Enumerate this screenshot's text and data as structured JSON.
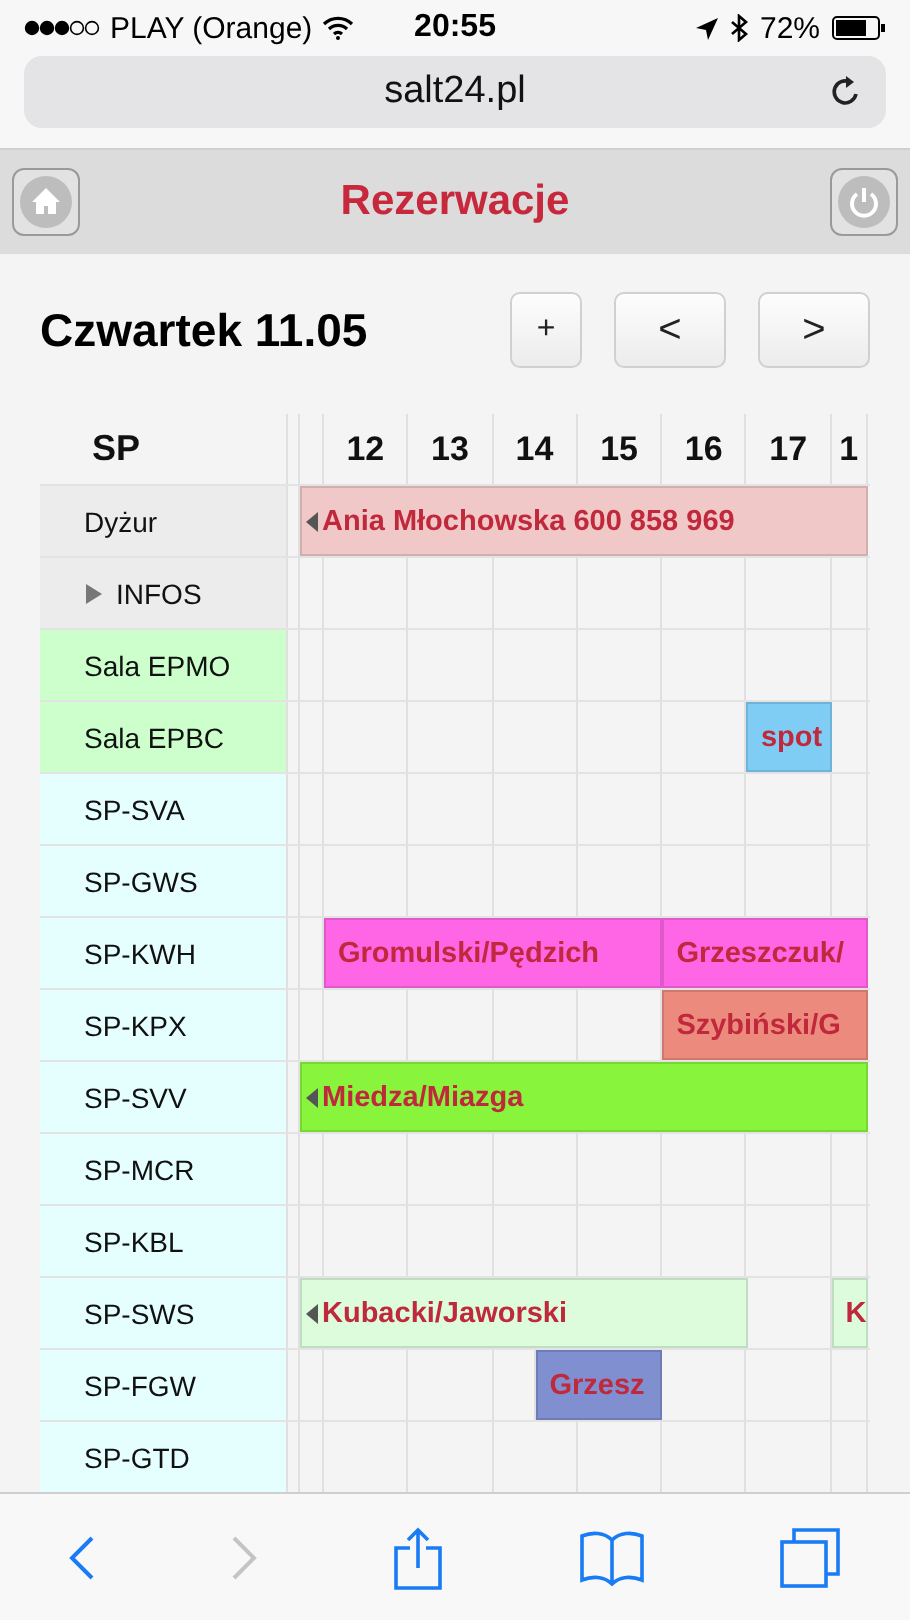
{
  "status_bar": {
    "carrier": "PLAY (Orange)",
    "time": "20:55",
    "battery": "72%"
  },
  "address_bar": {
    "url": "salt24.pl"
  },
  "header": {
    "title": "Rezerwacje"
  },
  "day": {
    "title": "Czwartek 11.05",
    "buttons": [
      "+",
      "<",
      ">"
    ]
  },
  "schedule": {
    "corner": "SP",
    "hours": [
      "12",
      "13",
      "14",
      "15",
      "16",
      "17",
      "1"
    ],
    "rows": [
      {
        "label": "Dyżur",
        "kind": "resource",
        "color": "#ececec",
        "cells": [
          {
            "kind": "booking",
            "text": "Ania Młochowska 600 858 969",
            "color": "#f0c8c8",
            "continues_before": true
          },
          {
            "kind": "covered"
          },
          {
            "kind": "covered"
          },
          {
            "kind": "covered"
          },
          {
            "kind": "covered"
          },
          {
            "kind": "covered"
          },
          {
            "kind": "covered"
          },
          {
            "kind": "covered"
          }
        ]
      },
      {
        "label": "INFOS",
        "kind": "group",
        "expanded": false,
        "color": "#ececec"
      },
      {
        "label": "Sala EPMO",
        "kind": "resource",
        "color": "#ccffcc"
      },
      {
        "label": "Sala EPBC",
        "kind": "resource",
        "color": "#ccffcc",
        "cells": [
          {
            "kind": "free"
          },
          {
            "kind": "free"
          },
          {
            "kind": "free"
          },
          {
            "kind": "free"
          },
          {
            "kind": "free"
          },
          {
            "kind": "free"
          },
          {
            "kind": "booking",
            "text": "spot",
            "color": "#7fcdf5",
            "continues_before": false
          },
          {
            "kind": "free"
          }
        ]
      },
      {
        "label": "SP-SVA",
        "kind": "resource",
        "color": "#e5ffff"
      },
      {
        "label": "SP-GWS",
        "kind": "resource",
        "color": "#e5ffff"
      },
      {
        "label": "SP-KWH",
        "kind": "resource",
        "color": "#e5ffff",
        "cells": [
          {
            "kind": "free"
          },
          {
            "kind": "booking",
            "text": "Gromulski/Pędzich",
            "color": "#ff66e6",
            "continues_before": false
          },
          {
            "kind": "covered"
          },
          {
            "kind": "covered"
          },
          {
            "kind": "covered"
          },
          {
            "kind": "booking",
            "text": "Grzeszczuk/",
            "color": "#ff66e6",
            "continues_before": false
          },
          {
            "kind": "covered"
          },
          {
            "kind": "covered"
          }
        ]
      },
      {
        "label": "SP-KPX",
        "kind": "resource",
        "color": "#e5ffff",
        "cells": [
          {
            "kind": "free"
          },
          {
            "kind": "free"
          },
          {
            "kind": "free"
          },
          {
            "kind": "free"
          },
          {
            "kind": "free"
          },
          {
            "kind": "booking",
            "text": "Szybiński/G",
            "color": "#ec8a7e",
            "continues_before": false
          },
          {
            "kind": "covered"
          },
          {
            "kind": "covered"
          }
        ]
      },
      {
        "label": "SP-SVV",
        "kind": "resource",
        "color": "#e5ffff",
        "cells": [
          {
            "kind": "booking",
            "text": "Miedza/Miazga",
            "color": "#88f53c",
            "continues_before": true
          },
          {
            "kind": "covered"
          },
          {
            "kind": "covered"
          },
          {
            "kind": "covered"
          },
          {
            "kind": "covered"
          },
          {
            "kind": "covered"
          },
          {
            "kind": "covered"
          },
          {
            "kind": "covered"
          }
        ]
      },
      {
        "label": "SP-MCR",
        "kind": "resource",
        "color": "#e5ffff"
      },
      {
        "label": "SP-KBL",
        "kind": "resource",
        "color": "#e5ffff"
      },
      {
        "label": "SP-SWS",
        "kind": "resource",
        "color": "#e5ffff",
        "cells": [
          {
            "kind": "booking",
            "text": "Kubacki/Jaworski",
            "color": "#dcfcdc",
            "continues_before": true
          },
          {
            "kind": "covered"
          },
          {
            "kind": "covered"
          },
          {
            "kind": "covered"
          },
          {
            "kind": "covered"
          },
          {
            "kind": "covered"
          },
          {
            "kind": "free"
          },
          {
            "kind": "booking",
            "text": "K",
            "color": "#dcfcdc",
            "continues_before": false
          }
        ]
      },
      {
        "label": "SP-FGW",
        "kind": "resource",
        "color": "#e5ffff",
        "cells": [
          {
            "kind": "free"
          },
          {
            "kind": "free"
          },
          {
            "kind": "free"
          },
          {
            "kind": "booking_half",
            "text": "Grzesz",
            "color": "#7f8fd0",
            "continues_before": false
          },
          {
            "kind": "covered"
          },
          {
            "kind": "free"
          },
          {
            "kind": "free"
          },
          {
            "kind": "free"
          }
        ]
      },
      {
        "label": "SP-GTD",
        "kind": "resource",
        "color": "#e5ffff"
      }
    ]
  }
}
